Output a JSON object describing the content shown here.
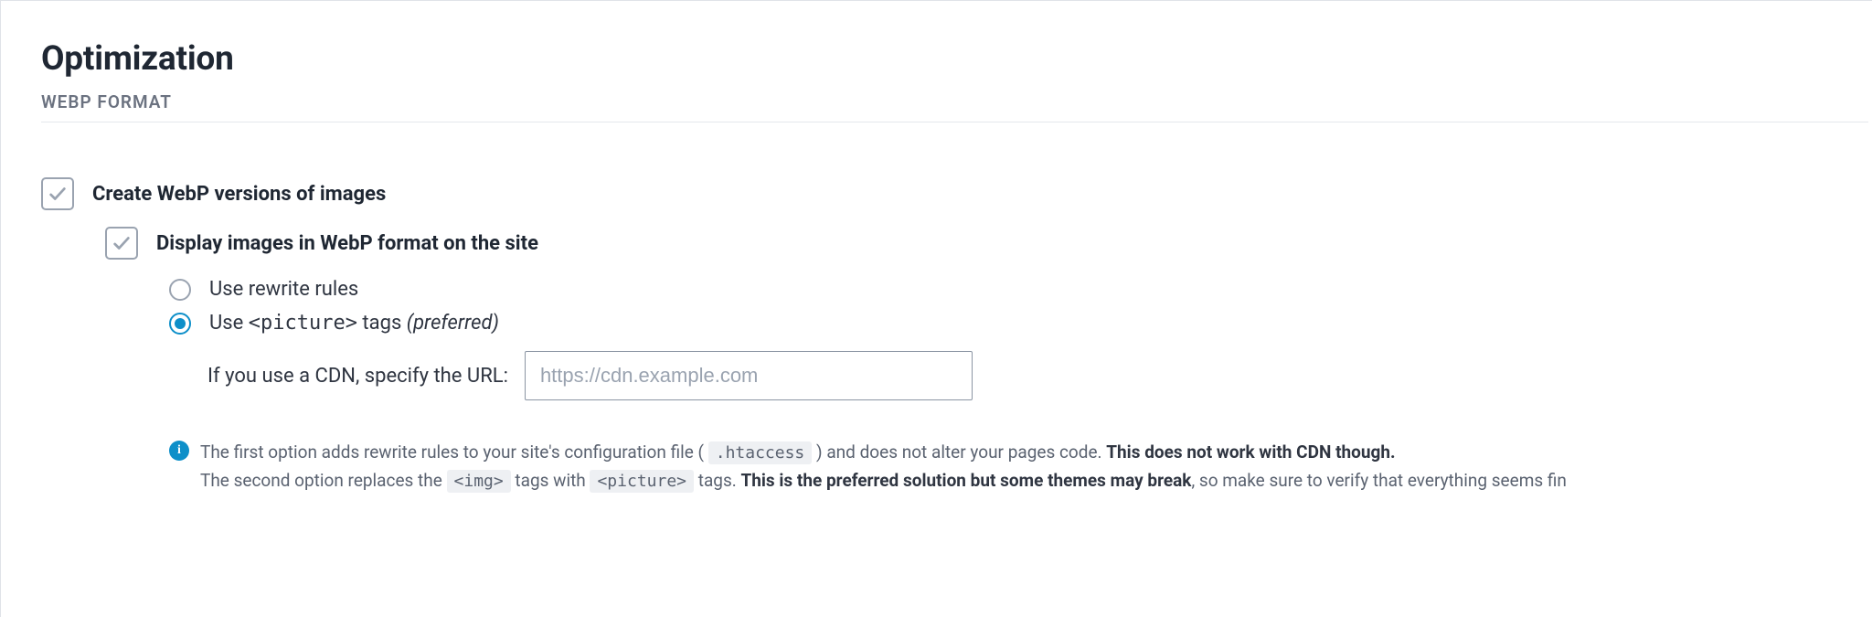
{
  "header": {
    "title": "Optimization",
    "section": "WEBP FORMAT"
  },
  "options": {
    "create_webp": {
      "checked": true,
      "label": "Create WebP versions of images"
    },
    "display_webp": {
      "checked": true,
      "label": "Display images in WebP format on the site"
    },
    "rewrite": {
      "selected": false,
      "label": "Use rewrite rules"
    },
    "picture": {
      "selected": true,
      "label_prefix": "Use ",
      "label_tag": "<picture>",
      "label_suffix": " tags ",
      "label_note": "(preferred)"
    },
    "cdn": {
      "label": "If you use a CDN, specify the URL:",
      "placeholder": "https://cdn.example.com",
      "value": ""
    }
  },
  "info": {
    "line1_a": "The first option adds rewrite rules to your site's configuration file ( ",
    "line1_code": ".htaccess",
    "line1_b": " ) and does not alter your pages code. ",
    "line1_strong": "This does not work with CDN though.",
    "line2_a": "The second option replaces the ",
    "line2_code1": "<img>",
    "line2_b": " tags with ",
    "line2_code2": "<picture>",
    "line2_c": " tags. ",
    "line2_strong": "This is the preferred solution but some themes may break",
    "line2_d": ", so make sure to verify that everything seems fin"
  }
}
